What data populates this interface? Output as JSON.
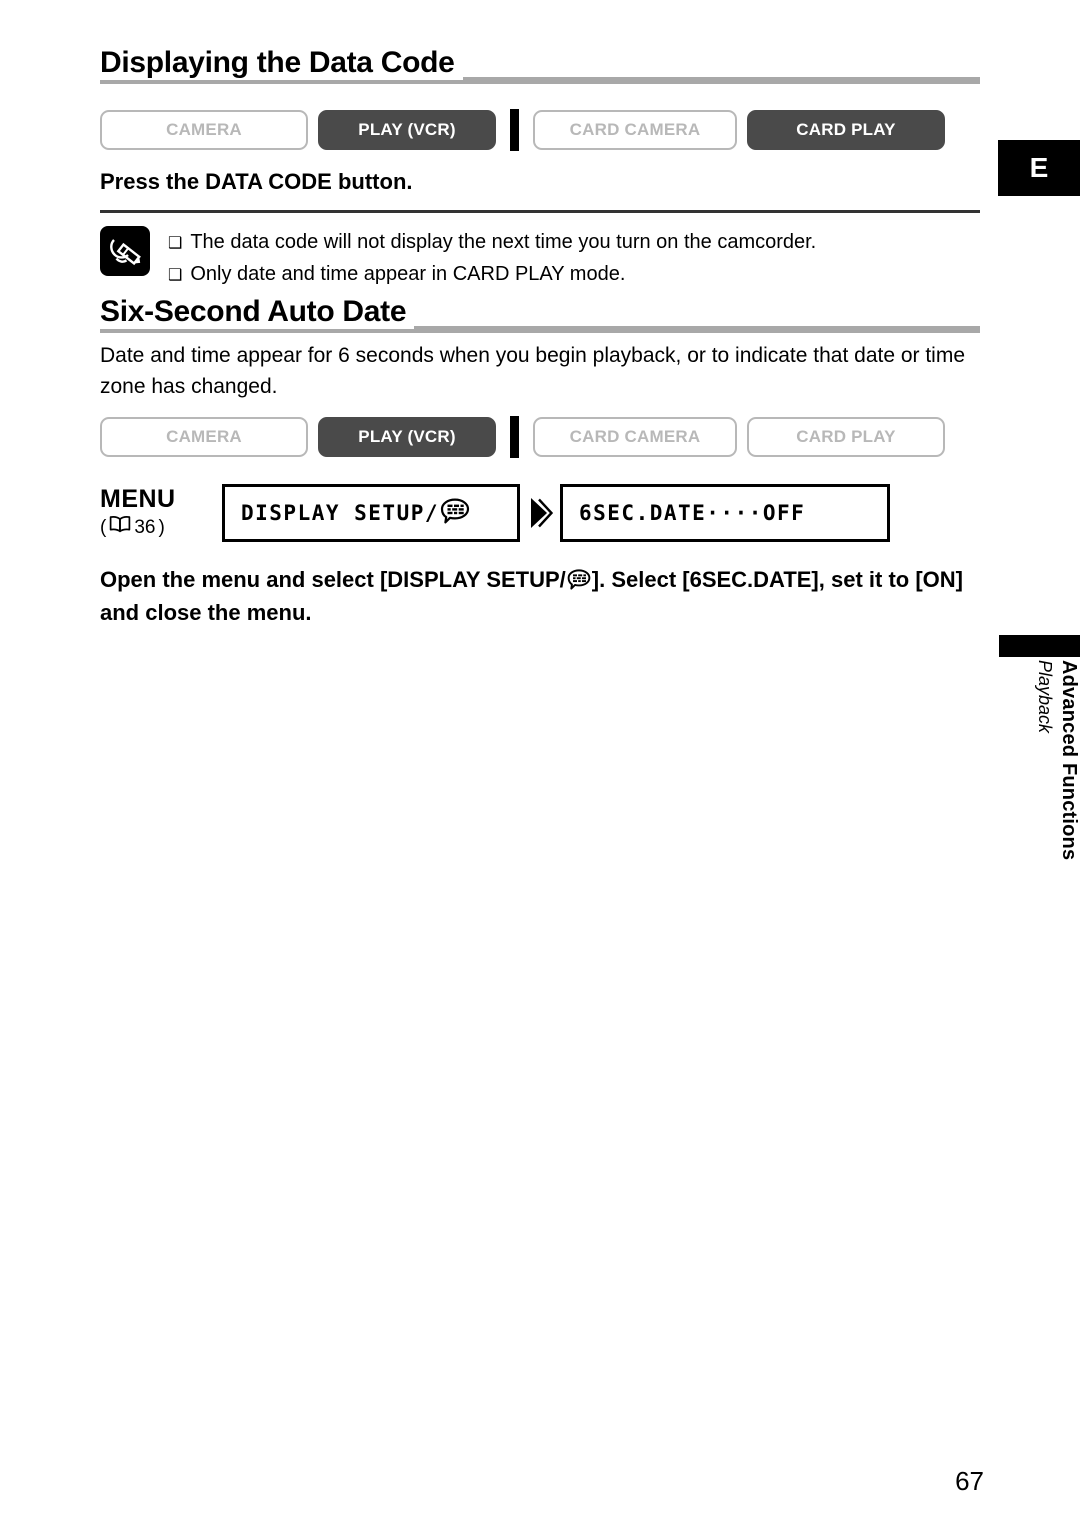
{
  "sections": [
    {
      "id": "data-code",
      "title": "Displaying the Data Code"
    },
    {
      "id": "auto-date",
      "title": "Six-Second Auto Date"
    }
  ],
  "mode_rows": [
    {
      "name": "data-code-modes",
      "buttons": [
        {
          "label": "CAMERA",
          "active": false
        },
        {
          "label": "PLAY (VCR)",
          "active": true
        },
        {
          "label": "CARD CAMERA",
          "active": false
        },
        {
          "label": "CARD PLAY",
          "active": true
        }
      ]
    },
    {
      "name": "auto-date-modes",
      "buttons": [
        {
          "label": "CAMERA",
          "active": false
        },
        {
          "label": "PLAY (VCR)",
          "active": true
        },
        {
          "label": "CARD CAMERA",
          "active": false
        },
        {
          "label": "CARD PLAY",
          "active": false
        }
      ]
    }
  ],
  "data_code": {
    "instruction": "Press the DATA CODE button.",
    "notes": {
      "icon": "note-pencil-icon",
      "bullet": "❑",
      "items": [
        "The data code will not display the next time you turn on the camcorder.",
        "Only date and time appear in CARD PLAY mode."
      ]
    }
  },
  "auto_date": {
    "paragraph": "Date and time appear for 6 seconds when you begin playback, or to indicate that date or time zone has changed.",
    "menu": {
      "label": "MENU",
      "ref_open": "(",
      "ref_page": "36",
      "ref_close": ")",
      "ref_icon": "open-book-icon",
      "box_1_text": "DISPLAY SETUP/",
      "box_1_icon": "on-screen-display-icon",
      "arrow_icon": "right-arrow-icon",
      "box_2_text": "6SEC.DATE····OFF"
    },
    "instruction_part_1": "Open the menu and select [DISPLAY SETUP/",
    "instruction_icon": "on-screen-display-icon",
    "instruction_part_2": "]. Select [6SEC.DATE], set it to [ON] and close the menu."
  },
  "margin": {
    "language_tab": "E",
    "chapter_title": "Advanced Functions",
    "chapter_subtitle": "Playback"
  },
  "footer": {
    "page_number": "67"
  },
  "colors": {
    "active_button": "#4a4a4a",
    "inactive_border": "#b8b8b8",
    "heading_rule": "#a8a8a8",
    "text": "#000000"
  }
}
